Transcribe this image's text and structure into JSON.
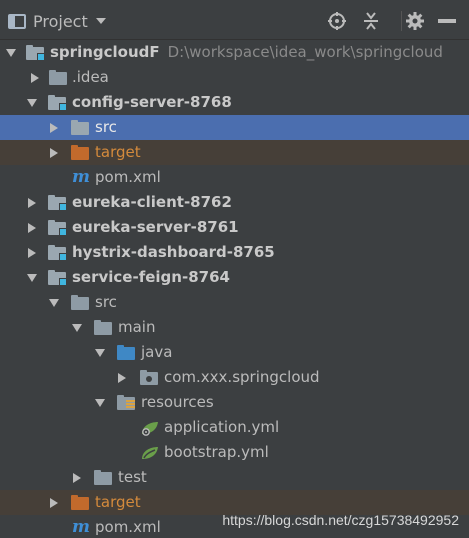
{
  "header": {
    "title": "Project"
  },
  "tree": {
    "rows": [
      {
        "label": "springcloudF",
        "path": "D:\\workspace\\idea_work\\springcloud"
      },
      {
        "label": ".idea"
      },
      {
        "label": "config-server-8768"
      },
      {
        "label": "src"
      },
      {
        "label": "target"
      },
      {
        "label": "pom.xml",
        "icon_text": "m"
      },
      {
        "label": "eureka-client-8762"
      },
      {
        "label": "eureka-server-8761"
      },
      {
        "label": "hystrix-dashboard-8765"
      },
      {
        "label": "service-feign-8764"
      },
      {
        "label": "src"
      },
      {
        "label": "main"
      },
      {
        "label": "java"
      },
      {
        "label": "com.xxx.springcloud"
      },
      {
        "label": "resources"
      },
      {
        "label": "application.yml"
      },
      {
        "label": "bootstrap.yml"
      },
      {
        "label": "test"
      },
      {
        "label": "target"
      },
      {
        "label": "pom.xml",
        "icon_text": "m"
      }
    ]
  },
  "watermark": "https://blog.csdn.net/czg15738492952",
  "colors": {
    "background": "#3c3f41",
    "selection": "#4b6eaf",
    "excluded_row": "#463f38",
    "module_badge": "#40b6e0",
    "excluded_folder": "#c26a2c",
    "source_folder": "#3f88c5"
  }
}
